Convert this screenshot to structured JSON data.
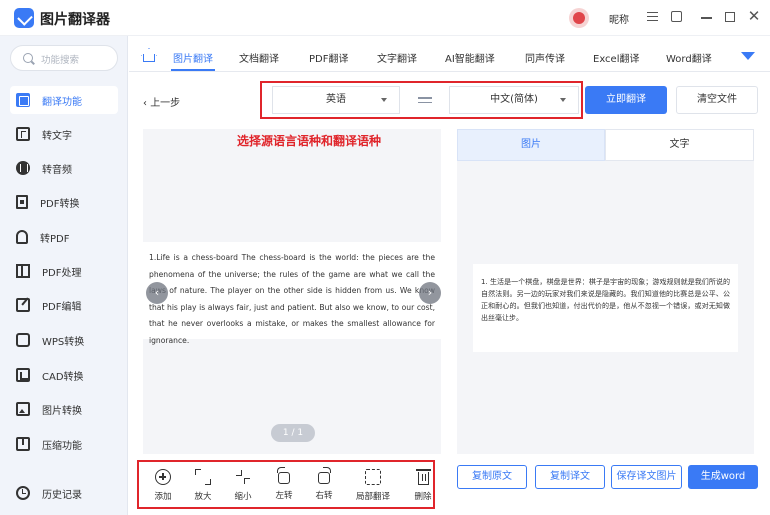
{
  "app": {
    "title": "图片翻译器",
    "nickname": "昵称"
  },
  "sidebar": {
    "search_placeholder": "功能搜索",
    "items": [
      {
        "label": "翻译功能",
        "icon": "translate-icon",
        "active": true
      },
      {
        "label": "转文字",
        "icon": "text-icon"
      },
      {
        "label": "转音频",
        "icon": "audio-icon"
      },
      {
        "label": "PDF转换",
        "icon": "pdf-convert-icon"
      },
      {
        "label": "转PDF",
        "icon": "to-pdf-icon"
      },
      {
        "label": "PDF处理",
        "icon": "pdf-process-icon"
      },
      {
        "label": "PDF编辑",
        "icon": "pdf-edit-icon"
      },
      {
        "label": "WPS转换",
        "icon": "wps-icon"
      },
      {
        "label": "CAD转换",
        "icon": "cad-icon"
      },
      {
        "label": "图片转换",
        "icon": "image-icon"
      },
      {
        "label": "压缩功能",
        "icon": "compress-icon"
      },
      {
        "label": "历史记录",
        "icon": "clock-icon"
      }
    ]
  },
  "tabs": [
    "图片翻译",
    "文档翻译",
    "PDF翻译",
    "文字翻译",
    "AI智能翻译",
    "同声传译",
    "Excel翻译",
    "Word翻译"
  ],
  "toolbar": {
    "back": "上一步",
    "source_lang": "英语",
    "target_lang": "中文(简体)",
    "translate_btn": "立即翻译",
    "clear_btn": "清空文件"
  },
  "annotation": "选择源语言语种和翻译语种",
  "preview": {
    "text": "1.Life is a chess-board The chess-board is the world: the pieces are the phenomena of the universe; the rules of the game are what we call the laws of nature. The player on the other side is hidden from us. We know that his play is always fair, just and patient. But also we know, to our cost, that he never overlooks a mistake, or makes the smallest allowance for ignorance.",
    "page": "1 / 1"
  },
  "tools": [
    "添加",
    "放大",
    "缩小",
    "左转",
    "右转",
    "局部翻译",
    "删除"
  ],
  "result": {
    "tab_image": "图片",
    "tab_text": "文字",
    "text": "1. 生活是一个棋盘，棋盘是世界：棋子是宇宙的现象；游戏规则就是我们所说的自然法则。另一边的玩家对我们来说是隐藏的。我们知道他的比赛总是公平、公正和耐心的。但我们也知道，付出代价的是，他从不忽视一个错误，或对无知做出丝毫让步。",
    "btn_copy_src": "复制原文",
    "btn_copy_trans": "复制译文",
    "btn_save_img": "保存译文图片",
    "btn_word": "生成word"
  }
}
